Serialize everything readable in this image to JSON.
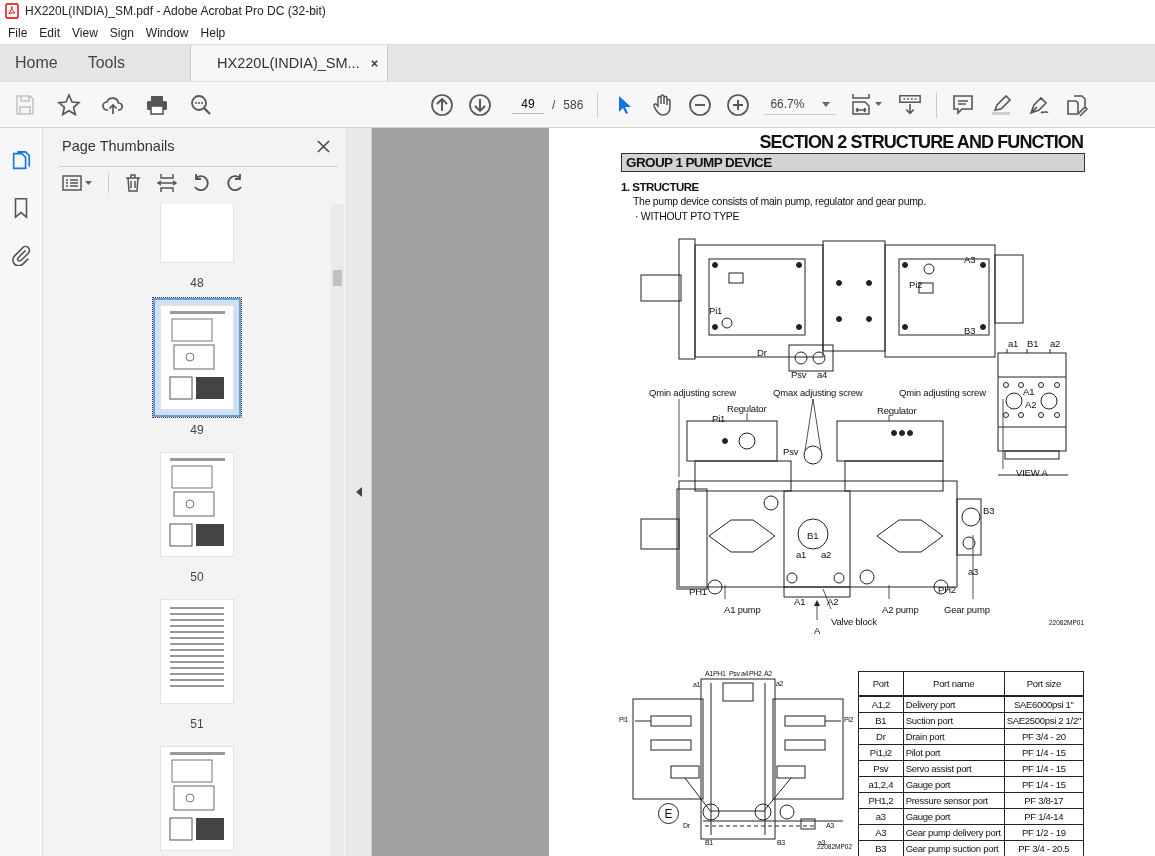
{
  "window": {
    "title": "HX220L(INDIA)_SM.pdf - Adobe Acrobat Pro DC (32-bit)"
  },
  "menu": [
    "File",
    "Edit",
    "View",
    "Sign",
    "Window",
    "Help"
  ],
  "tabs": [
    {
      "label": "Home",
      "selected": false,
      "closable": false
    },
    {
      "label": "Tools",
      "selected": false,
      "closable": false
    },
    {
      "label": "HX220L(INDIA)_SM...",
      "selected": true,
      "closable": true
    }
  ],
  "toolbar": {
    "left": [
      {
        "kind": "save",
        "disabled": true
      },
      {
        "kind": "star",
        "disabled": false
      },
      {
        "kind": "upload",
        "disabled": false
      },
      {
        "kind": "print",
        "disabled": false
      },
      {
        "kind": "search",
        "disabled": false
      }
    ],
    "page_current": "49",
    "page_separator": "/",
    "page_total": "586",
    "tools": [
      {
        "kind": "select",
        "selected": true
      },
      {
        "kind": "hand",
        "selected": false
      }
    ],
    "zoom": "66.7%"
  },
  "rail": [
    {
      "kind": "pages",
      "selected": true
    },
    {
      "kind": "bookmarks",
      "selected": false
    },
    {
      "kind": "attachments",
      "selected": false
    }
  ],
  "sidebar": {
    "title": "Page Thumbnails",
    "thumbnails": [
      {
        "label": "48",
        "selected": false,
        "kind": "blank"
      },
      {
        "label": "49",
        "selected": true,
        "kind": "drawing"
      },
      {
        "label": "50",
        "selected": false,
        "kind": "drawing"
      },
      {
        "label": "51",
        "selected": false,
        "kind": "text"
      },
      {
        "selected": false,
        "kind": "drawing"
      }
    ]
  },
  "document": {
    "section_title": "SECTION  2  STRUCTURE AND FUNCTION",
    "group_title": "GROUP  1  PUMP DEVICE",
    "heading": "1. STRUCTURE",
    "paragraph": "The pump device consists of main pump, regulator and gear pump.",
    "subheading": "· WITHOUT PTO TYPE",
    "figure_labels": [
      "A3",
      "Pi2",
      "Pi1",
      "B3",
      "Dr",
      "Psv",
      "a4",
      "a1",
      "B1",
      "a2",
      "A1",
      "A2",
      "VIEW  A",
      "Qmin adjusting screw",
      "Qmax adjusting screw",
      "Qmin adjusting screw",
      "Regulator",
      "Regulator",
      "Pi1",
      "Psv",
      "B3",
      "B1",
      "a1",
      "a2",
      "a3",
      "PH1",
      "PH2",
      "A1",
      "A2",
      "A1 pump",
      "A2 pump",
      "Gear pump",
      "Valve block",
      "A"
    ],
    "figure_code": "22082MP01",
    "schematic_labels": [
      "A1",
      "PH1",
      "Psv",
      "a4",
      "PH2",
      "A2",
      "a1",
      "a2",
      "Pi1",
      "Pi2",
      "E",
      "Dr",
      "A3",
      "B1",
      "B3",
      "a3"
    ],
    "schematic_code": "22082MP02",
    "table": {
      "columns": [
        "Port",
        "Port name",
        "Port size"
      ],
      "rows": [
        [
          "A1,2",
          "Delivery port",
          "SAE6000psi 1\""
        ],
        [
          "B1",
          "Suction port",
          "SAE2500psi 2 1/2\""
        ],
        [
          "Dr",
          "Drain port",
          "PF 3/4 - 20"
        ],
        [
          "Pi1,i2",
          "Pilot port",
          "PF 1/4 - 15"
        ],
        [
          "Psv",
          "Servo assist port",
          "PF 1/4 - 15"
        ],
        [
          "a1,2,4",
          "Gauge port",
          "PF 1/4 - 15"
        ],
        [
          "PH1,2",
          "Pressure sensor port",
          "PF 3/8-17"
        ],
        [
          "a3",
          "Gauge port",
          "PF 1/4-14"
        ],
        [
          "A3",
          "Gear pump delivery port",
          "PF 1/2 - 19"
        ],
        [
          "B3",
          "Gear pump suction port",
          "PF 3/4 - 20.5"
        ]
      ]
    }
  }
}
